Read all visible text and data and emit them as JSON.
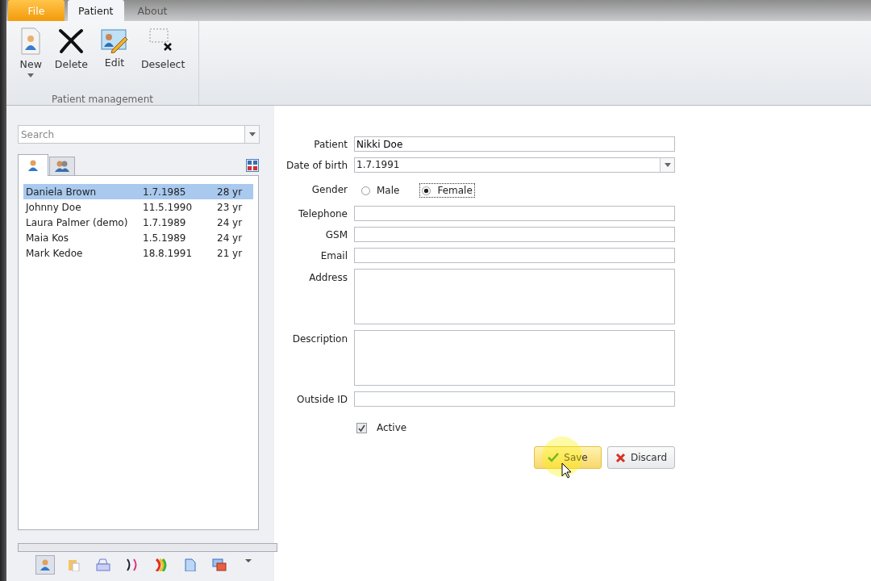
{
  "ribbon": {
    "tabs": [
      {
        "label": "File",
        "kind": "file",
        "selected": false
      },
      {
        "label": "Patient",
        "kind": "tab",
        "selected": true
      },
      {
        "label": "About",
        "kind": "tab",
        "selected": false
      }
    ],
    "groups": [
      {
        "title": "Patient management",
        "buttons": [
          {
            "label": "New",
            "kind": "new",
            "dropdown": true
          },
          {
            "label": "Delete",
            "kind": "delete",
            "dropdown": false
          },
          {
            "label": "Edit",
            "kind": "edit",
            "dropdown": false
          },
          {
            "label": "Deselect",
            "kind": "deselect",
            "dropdown": false
          }
        ]
      }
    ]
  },
  "sidebar": {
    "search": {
      "placeholder": "Search"
    },
    "tabs": [
      {
        "kind": "person",
        "selected": true
      },
      {
        "kind": "people",
        "selected": false
      }
    ],
    "patients": [
      {
        "name": "Daniela Brown",
        "birth": "1.7.1985",
        "age": "28 yr",
        "selected": true
      },
      {
        "name": "Johnny Doe",
        "birth": "11.5.1990",
        "age": "23 yr",
        "selected": false
      },
      {
        "name": "Laura Palmer (demo)",
        "birth": "1.7.1989",
        "age": "24 yr",
        "selected": false
      },
      {
        "name": "Maia Kos",
        "birth": "1.5.1989",
        "age": "24 yr",
        "selected": false
      },
      {
        "name": "Mark Kedoe",
        "birth": "18.8.1991",
        "age": "21 yr",
        "selected": false
      }
    ],
    "bottom_icons": [
      {
        "kind": "person",
        "selected": true
      },
      {
        "kind": "folder",
        "selected": false
      },
      {
        "kind": "printer",
        "selected": false
      },
      {
        "kind": "brackets",
        "selected": false
      },
      {
        "kind": "rainbow",
        "selected": false
      },
      {
        "kind": "document",
        "selected": false
      },
      {
        "kind": "windows",
        "selected": false
      },
      {
        "kind": "more",
        "selected": false
      }
    ]
  },
  "form": {
    "fields": [
      {
        "kind": "text",
        "label": "Patient",
        "value": "Nikki Doe"
      },
      {
        "kind": "dropdown",
        "label": "Date of birth",
        "value": "1.7.1991"
      },
      {
        "kind": "radio",
        "label": "Gender",
        "options": [
          {
            "label": "Male",
            "selected": false
          },
          {
            "label": "Female",
            "selected": true
          }
        ]
      },
      {
        "kind": "text",
        "label": "Telephone"
      },
      {
        "kind": "text",
        "label": "GSM"
      },
      {
        "kind": "text",
        "label": "Email"
      },
      {
        "kind": "textarea",
        "label": "Address"
      },
      {
        "kind": "textarea",
        "label": "Description"
      },
      {
        "kind": "text",
        "label": "Outside ID"
      },
      {
        "kind": "checkbox",
        "label": "Active",
        "checked": true
      }
    ],
    "buttons": [
      {
        "label": "Save",
        "kind": "save",
        "hovered": true
      },
      {
        "label": "Discard",
        "kind": "discard",
        "hovered": false
      }
    ]
  }
}
